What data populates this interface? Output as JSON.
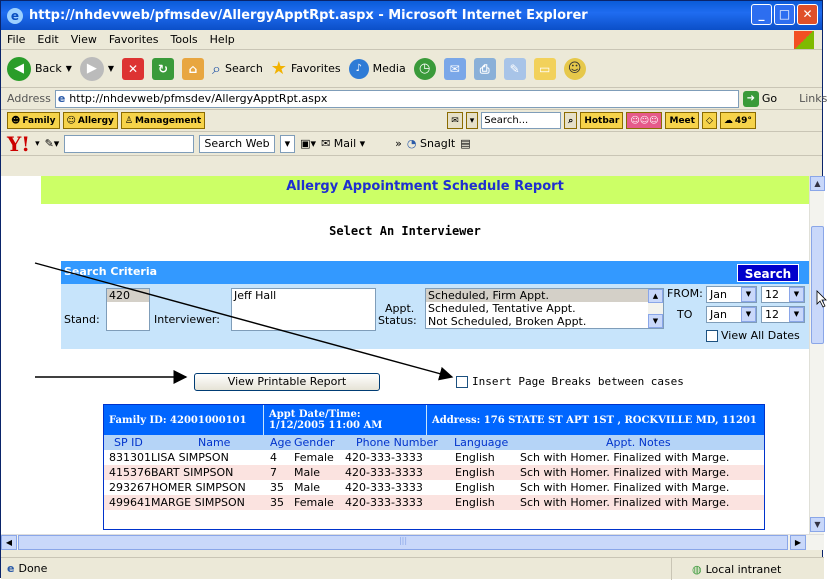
{
  "window": {
    "title": "http://nhdevweb/pfmsdev/AllergyApptRpt.aspx - Microsoft Internet Explorer"
  },
  "menu": [
    "File",
    "Edit",
    "View",
    "Favorites",
    "Tools",
    "Help"
  ],
  "toolbar": {
    "back": "Back",
    "search": "Search",
    "favorites": "Favorites",
    "media": "Media"
  },
  "address": {
    "label": "Address",
    "url": "http://nhdevweb/pfmsdev/AllergyApptRpt.aspx",
    "go": "Go",
    "links": "Links"
  },
  "linksbar": {
    "family": "Family",
    "allergy": "Allergy",
    "management": "Management",
    "search_placeholder": "Search...",
    "hotbar": "Hotbar",
    "meet": "Meet",
    "temp": "49°"
  },
  "yahoo": {
    "logo": "Y!",
    "search_web": "Search Web",
    "mail": "Mail",
    "snagit": "SnagIt"
  },
  "report": {
    "title": "Allergy Appointment Schedule Report",
    "subtitle": "Select An Interviewer"
  },
  "criteria": {
    "header": "Search Criteria",
    "search_button": "Search",
    "stand_label": "Stand:",
    "stand_value": "420",
    "interviewer_label": "Interviewer:",
    "interviewer_value": "Jeff Hall",
    "appt_label_1": "Appt.",
    "appt_label_2": "Status:",
    "status_options": [
      "Scheduled, Firm Appt.",
      "Scheduled, Tentative Appt.",
      "Not Scheduled, Broken Appt."
    ],
    "from_label": "FROM:",
    "to_label": "TO",
    "from_month": "Jan",
    "from_day": "12",
    "to_month": "Jan",
    "to_day": "12",
    "view_all_dates": "View All Dates"
  },
  "actions": {
    "print_button": "View Printable Report",
    "page_breaks": "Insert Page Breaks between cases"
  },
  "family": {
    "id_label": "Family ID: 42001000101",
    "appt_label": "Appt Date/Time:",
    "appt_value": "1/12/2005 11:00 AM",
    "address": "Address: 176 STATE ST APT 1ST , ROCKVILLE MD, 11201",
    "columns": [
      "SP ID",
      "Name",
      "Age",
      "Gender",
      "Phone Number",
      "Language",
      "Appt. Notes"
    ],
    "rows": [
      [
        "831301",
        "LISA SIMPSON",
        "4",
        "Female",
        "420-333-3333",
        "English",
        "Sch with Homer. Finalized with Marge."
      ],
      [
        "415376",
        "BART SIMPSON",
        "7",
        "Male",
        "420-333-3333",
        "English",
        "Sch with Homer. Finalized with Marge."
      ],
      [
        "293267",
        "HOMER SIMPSON",
        "35",
        "Male",
        "420-333-3333",
        "English",
        "Sch with Homer. Finalized with Marge."
      ],
      [
        "499641",
        "MARGE SIMPSON",
        "35",
        "Female",
        "420-333-3333",
        "English",
        "Sch with Homer. Finalized with Marge."
      ]
    ]
  },
  "status": {
    "left": "Done",
    "zone": "Local intranet"
  }
}
